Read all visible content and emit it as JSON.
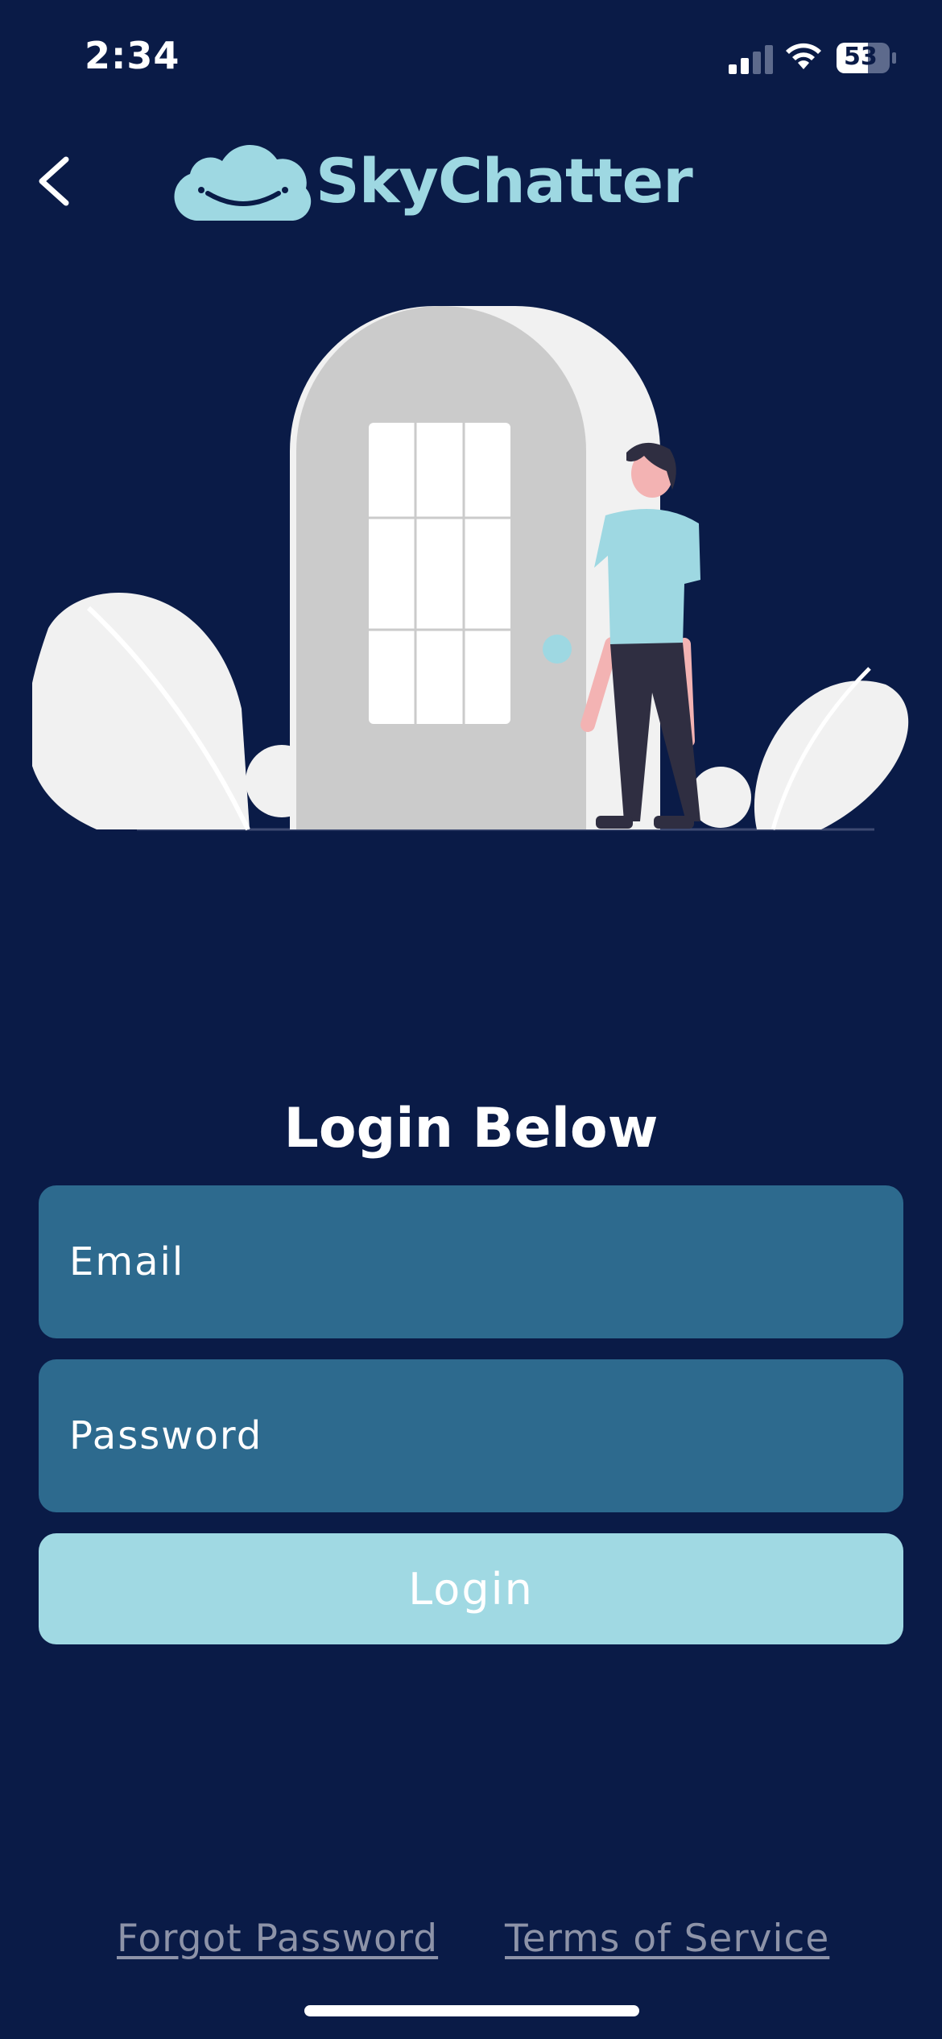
{
  "status_bar": {
    "time": "2:34",
    "battery_level": "53"
  },
  "header": {
    "app_name": "SkyChatter",
    "logo_icon": "cloud-smile-icon",
    "back_icon": "chevron-left-icon"
  },
  "login": {
    "title": "Login Below",
    "email_placeholder": "Email",
    "email_value": "",
    "password_placeholder": "Password",
    "password_value": "",
    "button_label": "Login"
  },
  "footer": {
    "forgot_password": "Forgot Password",
    "terms_of_service": "Terms of Service"
  },
  "colors": {
    "background": "#0a1b47",
    "accent": "#a0d9e3",
    "field_background": "#2d6a8e",
    "footer_link": "#8d93a8"
  }
}
